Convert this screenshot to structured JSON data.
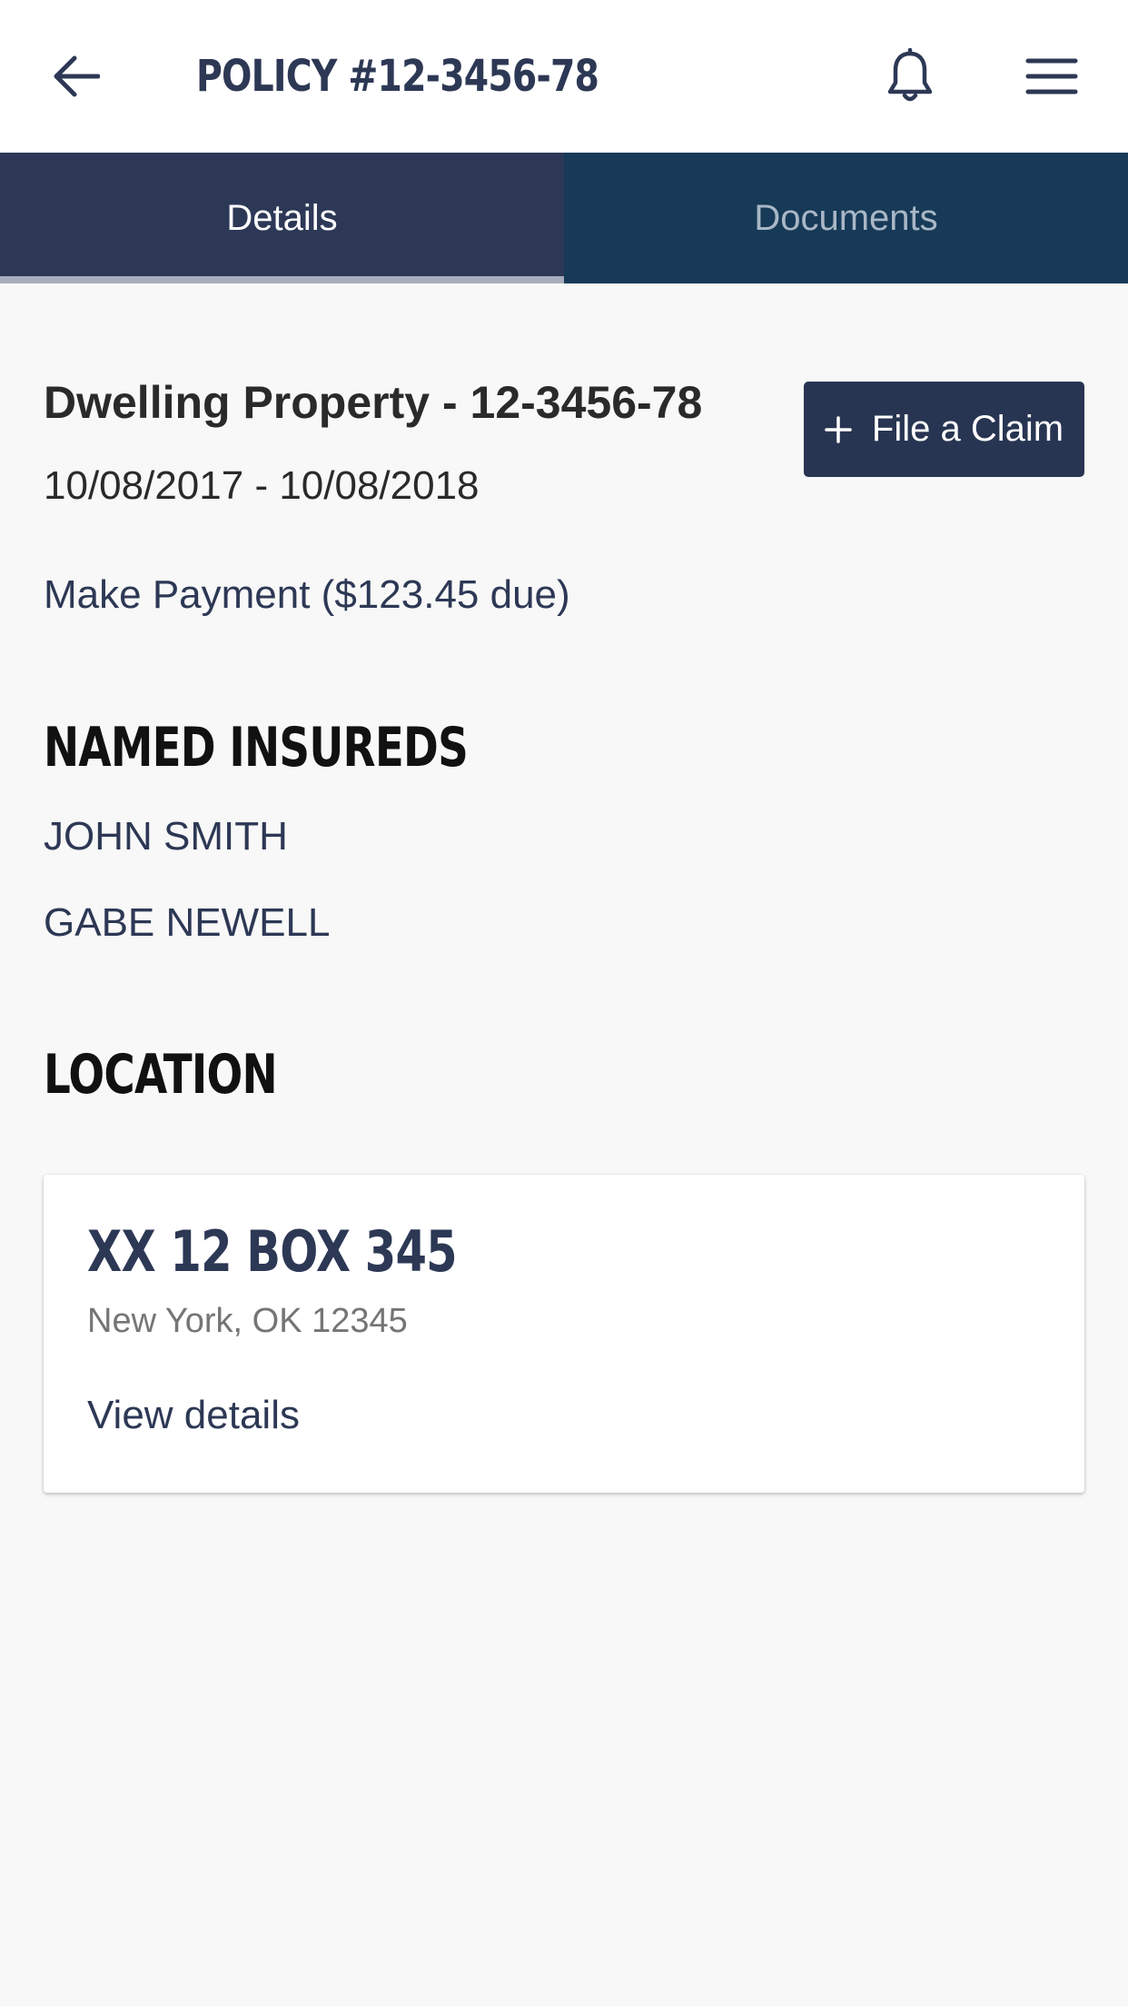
{
  "header": {
    "title": "POLICY #12-3456-78",
    "back_icon": "arrow-left-icon",
    "bell_icon": "bell-icon",
    "menu_icon": "hamburger-menu-icon"
  },
  "tabs": [
    {
      "label": "Details",
      "active": true
    },
    {
      "label": "Documents",
      "active": false
    }
  ],
  "policy": {
    "name": "Dwelling Property - 12-3456-78",
    "dates": "10/08/2017 - 10/08/2018",
    "payment_link": "Make Payment ($123.45 due)",
    "claim_button": "File a Claim"
  },
  "named_insureds": {
    "heading": "NAMED INSUREDS",
    "names": [
      "JOHN SMITH",
      "GABE NEWELL"
    ]
  },
  "location": {
    "heading": "LOCATION",
    "address": "XX 12 BOX 345",
    "city": "New York, OK 12345",
    "link": "View details"
  },
  "colors": {
    "navy": "#2d3857",
    "tab_inactive": "#163a57",
    "button": "#283552",
    "background": "#f8f8f8"
  }
}
